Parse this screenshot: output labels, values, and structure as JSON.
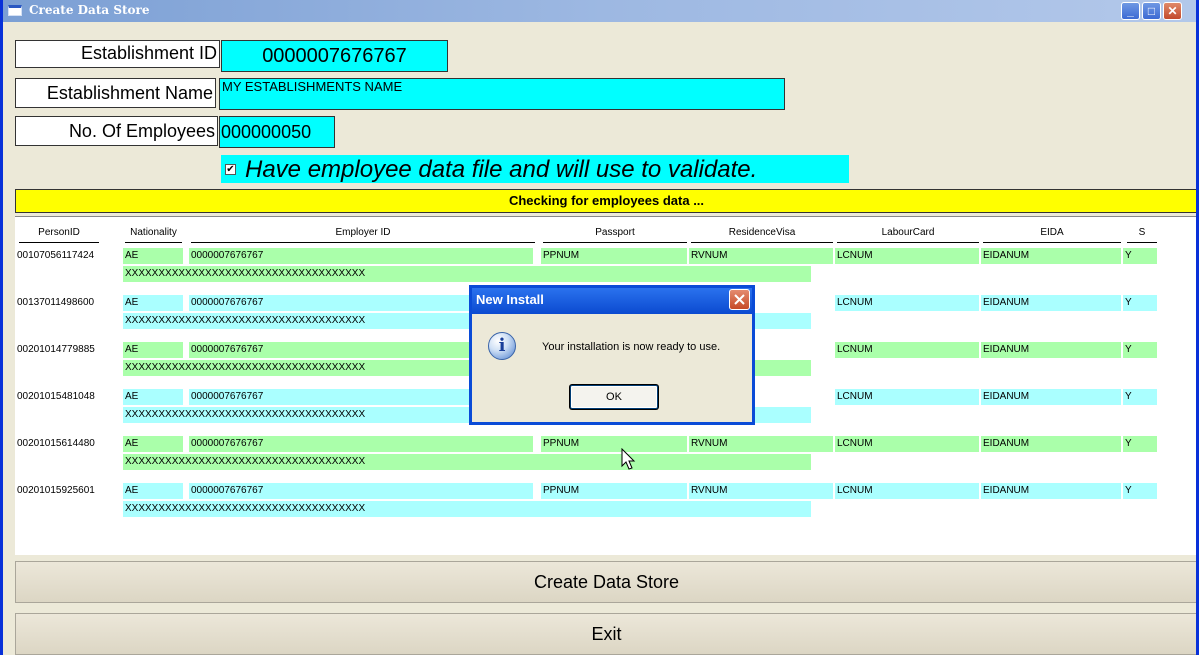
{
  "window": {
    "title": "Create Data Store"
  },
  "form": {
    "est_id_label": "Establishment ID",
    "est_id_value": "0000007676767",
    "est_name_label": "Establishment Name",
    "est_name_value": "MY ESTABLISHMENTS NAME",
    "employees_label": "No. Of Employees",
    "employees_value": "000000050",
    "checkbox_label": "Have employee data file and will use to validate.",
    "checkbox_checked": true
  },
  "status": {
    "text": "Checking for employees data ..."
  },
  "table": {
    "columns": [
      "PersonID",
      "Nationality",
      "Employer ID",
      "Passport",
      "ResidenceVisa",
      "LabourCard",
      "EIDA",
      "S"
    ],
    "rows": [
      {
        "person_id": "00107056117424",
        "nationality": "AE",
        "employer_id": "0000007676767",
        "passport": "PPNUM",
        "residence_visa": "RVNUM",
        "labour_card": "LCNUM",
        "eida": "EIDANUM",
        "s": "Y",
        "name": "XXXXXXXXXXXXXXXXXXXXXXXXXXXXXXXXXXXX"
      },
      {
        "person_id": "00137011498600",
        "nationality": "AE",
        "employer_id": "0000007676767",
        "passport": "",
        "residence_visa": "",
        "labour_card": "LCNUM",
        "eida": "EIDANUM",
        "s": "Y",
        "name": "XXXXXXXXXXXXXXXXXXXXXXXXXXXXXXXXXXXX"
      },
      {
        "person_id": "00201014779885",
        "nationality": "AE",
        "employer_id": "0000007676767",
        "passport": "",
        "residence_visa": "",
        "labour_card": "LCNUM",
        "eida": "EIDANUM",
        "s": "Y",
        "name": "XXXXXXXXXXXXXXXXXXXXXXXXXXXXXXXXXXXX"
      },
      {
        "person_id": "00201015481048",
        "nationality": "AE",
        "employer_id": "0000007676767",
        "passport": "",
        "residence_visa": "",
        "labour_card": "LCNUM",
        "eida": "EIDANUM",
        "s": "Y",
        "name": "XXXXXXXXXXXXXXXXXXXXXXXXXXXXXXXXXXXX"
      },
      {
        "person_id": "00201015614480",
        "nationality": "AE",
        "employer_id": "0000007676767",
        "passport": "PPNUM",
        "residence_visa": "RVNUM",
        "labour_card": "LCNUM",
        "eida": "EIDANUM",
        "s": "Y",
        "name": "XXXXXXXXXXXXXXXXXXXXXXXXXXXXXXXXXXXX"
      },
      {
        "person_id": "00201015925601",
        "nationality": "AE",
        "employer_id": "0000007676767",
        "passport": "PPNUM",
        "residence_visa": "RVNUM",
        "labour_card": "LCNUM",
        "eida": "EIDANUM",
        "s": "Y",
        "name": "XXXXXXXXXXXXXXXXXXXXXXXXXXXXXXXXXXXX"
      }
    ]
  },
  "buttons": {
    "create": "Create Data Store",
    "exit": "Exit"
  },
  "dialog": {
    "title": "New Install",
    "message": "Your installation is now ready to use.",
    "ok": "OK"
  },
  "colors": {
    "field": "#00ffff",
    "status": "#ffff00",
    "row_green": "#aaffaa",
    "row_cyan": "#aaffff",
    "titlebar": "#7b9fd4"
  }
}
